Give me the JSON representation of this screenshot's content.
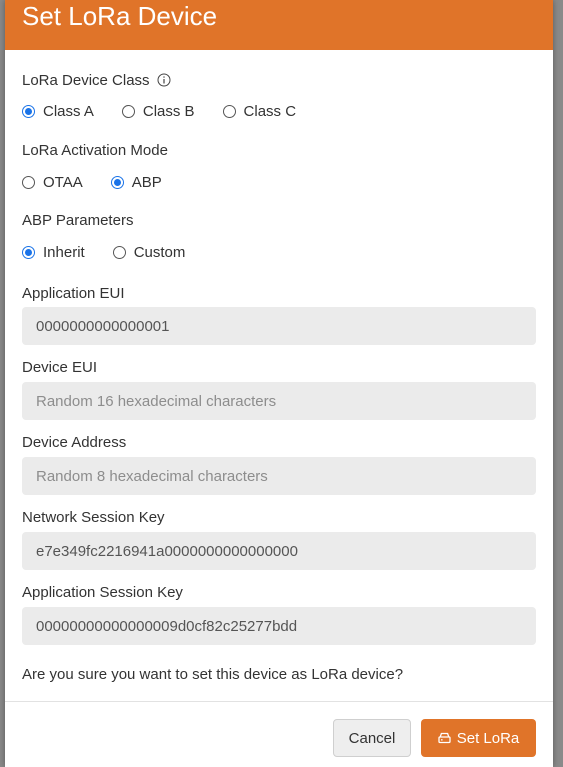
{
  "modal": {
    "title": "Set LoRa Device",
    "device_class": {
      "label": "LoRa Device Class",
      "info_icon": "info-icon",
      "options": [
        "Class A",
        "Class B",
        "Class C"
      ],
      "selected": "Class A"
    },
    "activation_mode": {
      "label": "LoRa Activation Mode",
      "options": [
        "OTAA",
        "ABP"
      ],
      "selected": "ABP"
    },
    "abp_parameters": {
      "label": "ABP Parameters",
      "options": [
        "Inherit",
        "Custom"
      ],
      "selected": "Inherit"
    },
    "application_eui": {
      "label": "Application EUI",
      "value": "0000000000000001"
    },
    "device_eui": {
      "label": "Device EUI",
      "placeholder": "Random 16 hexadecimal characters"
    },
    "device_address": {
      "label": "Device Address",
      "placeholder": "Random 8 hexadecimal characters"
    },
    "network_session_key": {
      "label": "Network Session Key",
      "value": "e7e349fc2216941a0000000000000000"
    },
    "application_session_key": {
      "label": "Application Session Key",
      "value": "00000000000000009d0cf82c25277bdd"
    },
    "confirm_text": "Are you sure you want to set this device as LoRa device?",
    "buttons": {
      "cancel": "Cancel",
      "set": "Set LoRa",
      "set_icon": "router-icon"
    }
  },
  "colors": {
    "accent": "#e07429",
    "radio_checked": "#1a73e8",
    "input_bg": "#ebebeb"
  }
}
